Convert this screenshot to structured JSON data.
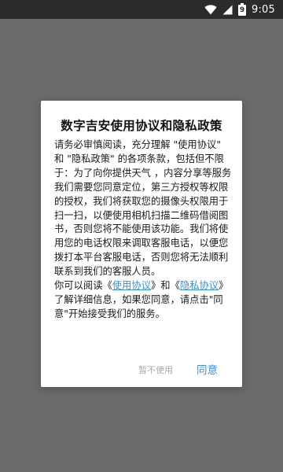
{
  "status_bar": {
    "time": "9:05",
    "battery_level": "9",
    "icons": [
      "wifi-icon",
      "cellular-signal-icon",
      "battery-icon"
    ]
  },
  "dialog": {
    "title": "数字吉安使用协议和隐私政策",
    "body_intro": "请务必审慎阅读，充分理解 \"使用协议\" 和 \"隐私政策\" 的各项条款，包括但不限于：为了向你提供天气 ，内容分享等服务我们需要您同意定位，第三方授权等权限的授权，我们将获取您的摄像头权限用于扫一扫，以便使用相机扫描二维码借阅图书，否则您将不能使用该功能。我们将使用您的电话权限来调取客服电话，以便您拨打本平台客服电话，否则您将无法顺利联系到我们的客服人员。",
    "body_prefix": "你可以阅读《",
    "link_terms": "使用协议",
    "body_between": "》和《",
    "link_privacy": "隐私协议",
    "body_suffix": "》了解详细信息，如果您同意，请点击\"同意\"开始接受我们的服务。",
    "decline_label": "暂不使用",
    "agree_label": "同意"
  },
  "colors": {
    "accent": "#3b8fd8",
    "overlay": "#6b6b6b",
    "status_bar": "#2b2b2b",
    "decline_text": "#a8a8a8"
  }
}
